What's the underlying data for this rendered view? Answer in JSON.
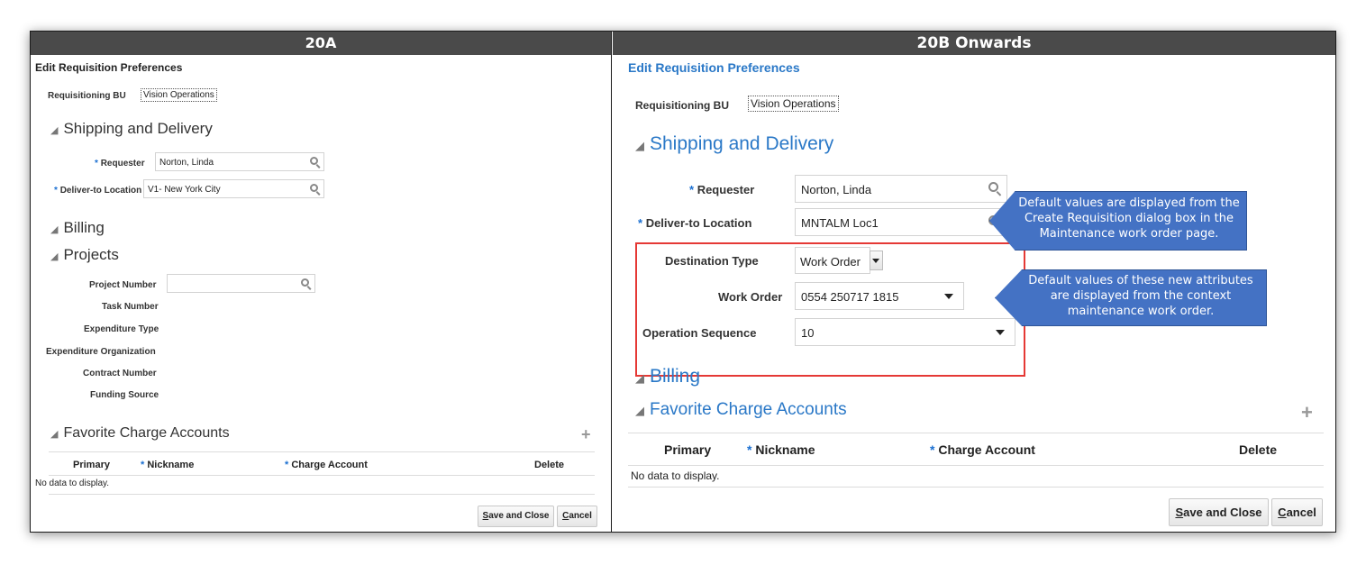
{
  "left": {
    "header": "20A",
    "page_title": "Edit Requisition Preferences",
    "req_bu_label": "Requisitioning BU",
    "req_bu_value": "Vision Operations",
    "shipping_title": "Shipping and Delivery",
    "requester_label": "Requester",
    "requester_value": "Norton, Linda",
    "deliver_label": "Deliver-to Location",
    "deliver_value": "V1- New York City",
    "billing_title": "Billing",
    "projects_title": "Projects",
    "project_number_label": "Project Number",
    "task_number_label": "Task Number",
    "expenditure_type_label": "Expenditure Type",
    "expenditure_org_label": "Expenditure Organization",
    "contract_number_label": "Contract Number",
    "funding_source_label": "Funding Source",
    "fav_title": "Favorite Charge Accounts",
    "col_primary": "Primary",
    "col_nickname": "Nickname",
    "col_charge_account": "Charge Account",
    "col_delete": "Delete",
    "no_data": "No data to display.",
    "save_close_first": "S",
    "save_close_rest": "ave and Close",
    "cancel_first": "C",
    "cancel_rest": "ancel"
  },
  "right": {
    "header": "20B Onwards",
    "page_title": "Edit Requisition Preferences",
    "req_bu_label": "Requisitioning BU",
    "req_bu_value": "Vision Operations",
    "shipping_title": "Shipping and Delivery",
    "requester_label": "Requester",
    "requester_value": "Norton, Linda",
    "deliver_label": "Deliver-to Location",
    "deliver_value": "MNTALM Loc1",
    "destination_type_label": "Destination Type",
    "destination_type_value": "Work Order",
    "work_order_label": "Work Order",
    "work_order_value": "0554 250717 1815",
    "op_seq_label": "Operation Sequence",
    "op_seq_value": "10",
    "billing_title": "Billing",
    "fav_title": "Favorite Charge Accounts",
    "col_primary": "Primary",
    "col_nickname": "Nickname",
    "col_charge_account": "Charge Account",
    "col_delete": "Delete",
    "no_data": "No data to display.",
    "save_close_first": "S",
    "save_close_rest": "ave and Close",
    "cancel_first": "C",
    "cancel_rest": "ancel"
  },
  "callouts": {
    "first": [
      "Default values are displayed from the",
      "Create Requisition dialog box in the",
      "Maintenance work order page."
    ],
    "second": [
      "Default values of these new attributes",
      "are displayed from the context",
      "maintenance work order."
    ]
  },
  "required_marker": "*",
  "colors": {
    "header_bg": "#4a4a4a",
    "title_blue": "#2a78c7",
    "required_blue": "#1a6fd1",
    "callout_bg": "#4472c4",
    "highlight_red": "#e53935"
  }
}
